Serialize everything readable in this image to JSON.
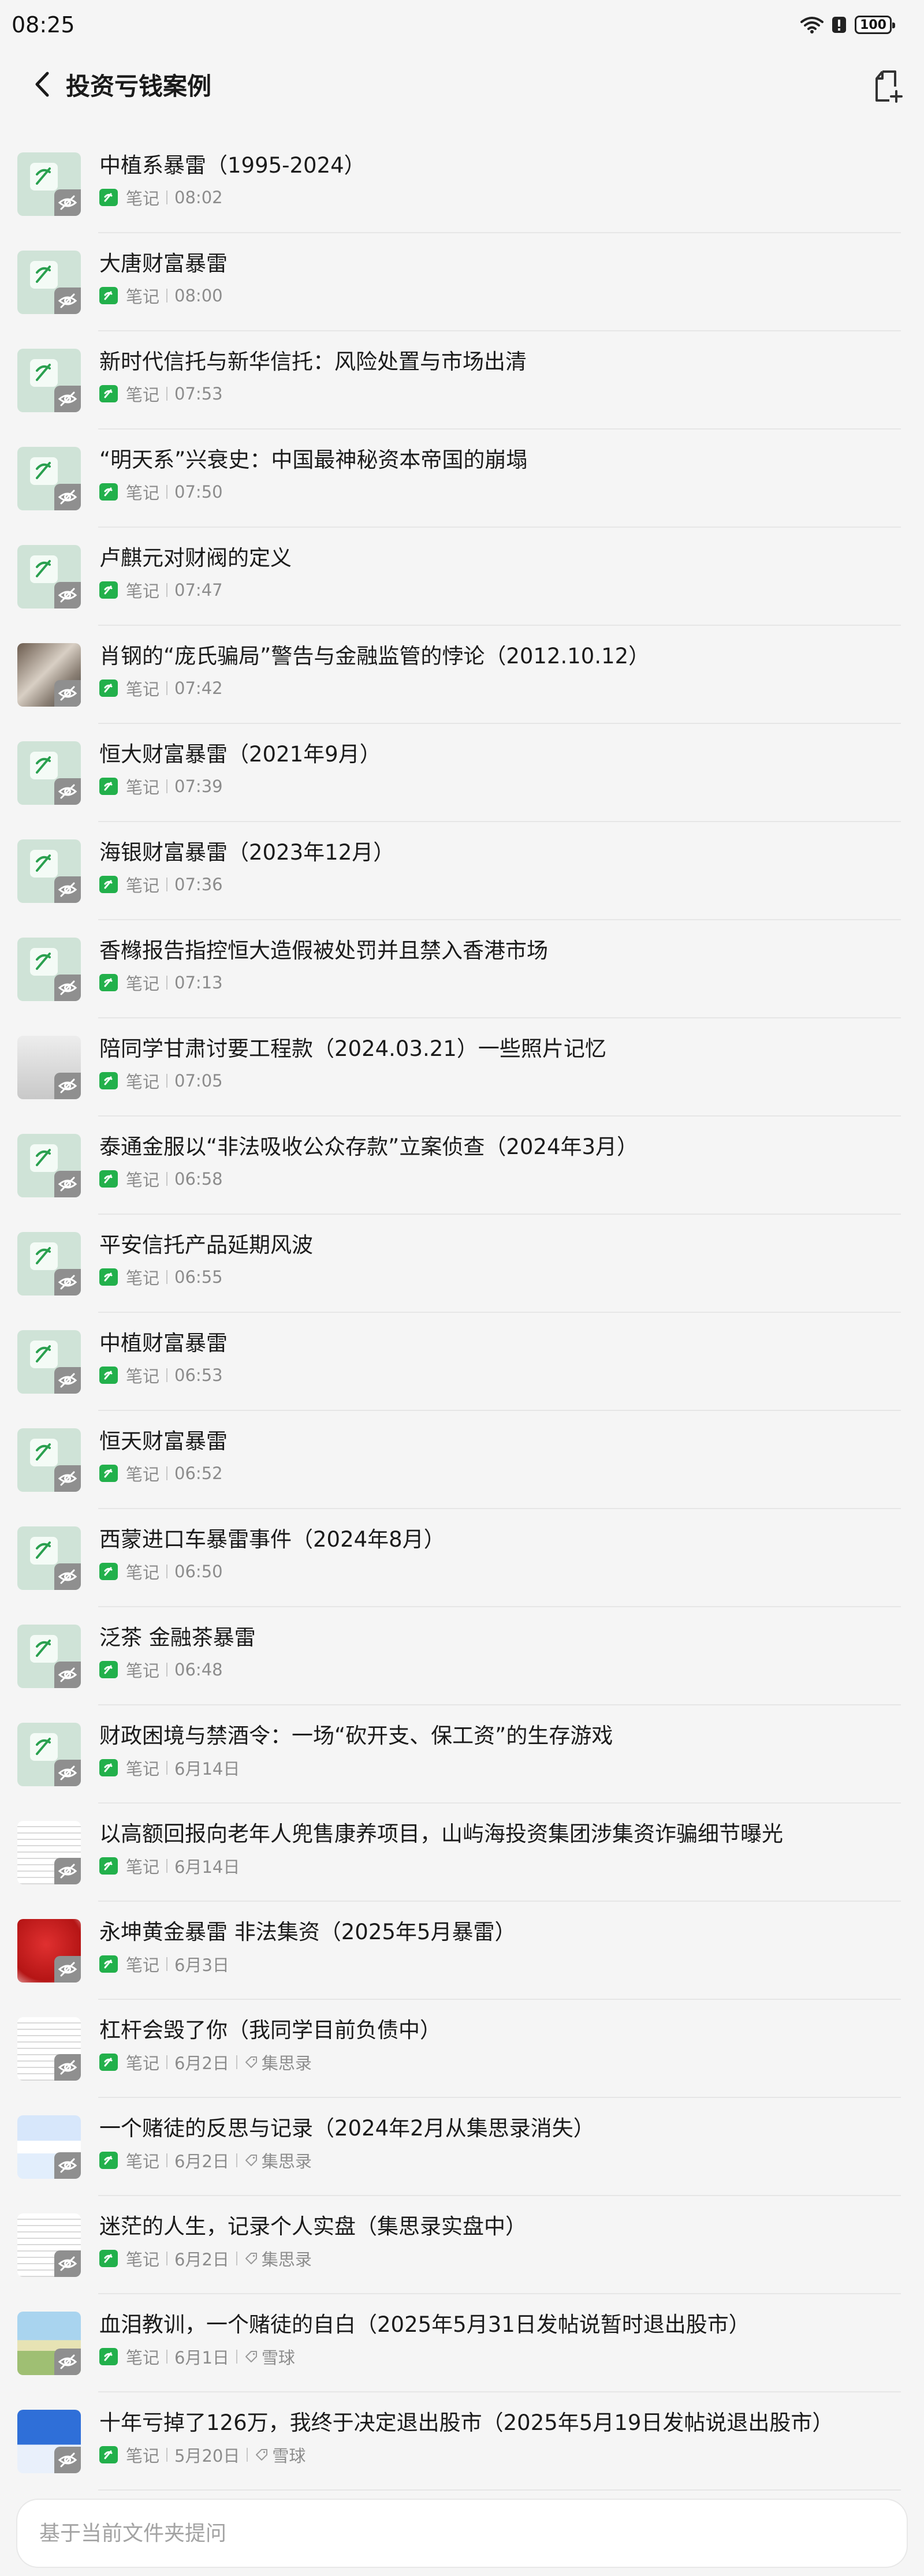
{
  "status": {
    "time": "08:25",
    "battery": "100"
  },
  "header": {
    "title": "投资亏钱案例"
  },
  "notes": [
    {
      "title": "中植系暴雷（1995-2024）",
      "type": "笔记",
      "time": "08:02",
      "tag": "",
      "thumb": "default"
    },
    {
      "title": "大唐财富暴雷",
      "type": "笔记",
      "time": "08:00",
      "tag": "",
      "thumb": "default"
    },
    {
      "title": "新时代信托与新华信托：风险处置与市场出清",
      "type": "笔记",
      "time": "07:53",
      "tag": "",
      "thumb": "default"
    },
    {
      "title": "“明天系”兴衰史：中国最神秘资本帝国的崩塌",
      "type": "笔记",
      "time": "07:50",
      "tag": "",
      "thumb": "default"
    },
    {
      "title": "卢麒元对财阀的定义",
      "type": "笔记",
      "time": "07:47",
      "tag": "",
      "thumb": "default"
    },
    {
      "title": "肖钢的“庞氏骗局”警告与金融监管的悖论（2012.10.12）",
      "type": "笔记",
      "time": "07:42",
      "tag": "",
      "thumb": "photo"
    },
    {
      "title": "恒大财富暴雷（2021年9月）",
      "type": "笔记",
      "time": "07:39",
      "tag": "",
      "thumb": "default"
    },
    {
      "title": "海银财富暴雷（2023年12月）",
      "type": "笔记",
      "time": "07:36",
      "tag": "",
      "thumb": "default"
    },
    {
      "title": "香橼报告指控恒大造假被处罚并且禁入香港市场",
      "type": "笔记",
      "time": "07:13",
      "tag": "",
      "thumb": "default"
    },
    {
      "title": "陪同学甘肃讨要工程款（2024.03.21）一些照片记忆",
      "type": "笔记",
      "time": "07:05",
      "tag": "",
      "thumb": "doc"
    },
    {
      "title": "泰通金服以“非法吸收公众存款”立案侦查（2024年3月）",
      "type": "笔记",
      "time": "06:58",
      "tag": "",
      "thumb": "default"
    },
    {
      "title": "平安信托产品延期风波",
      "type": "笔记",
      "time": "06:55",
      "tag": "",
      "thumb": "default"
    },
    {
      "title": "中植财富暴雷",
      "type": "笔记",
      "time": "06:53",
      "tag": "",
      "thumb": "default"
    },
    {
      "title": "恒天财富暴雷",
      "type": "笔记",
      "time": "06:52",
      "tag": "",
      "thumb": "default"
    },
    {
      "title": "西蒙进口车暴雷事件（2024年8月）",
      "type": "笔记",
      "time": "06:50",
      "tag": "",
      "thumb": "default"
    },
    {
      "title": "泛茶 金融茶暴雷",
      "type": "笔记",
      "time": "06:48",
      "tag": "",
      "thumb": "default"
    },
    {
      "title": "财政困境与禁酒令：一场“砍开支、保工资”的生存游戏",
      "type": "笔记",
      "time": "6月14日",
      "tag": "",
      "thumb": "default"
    },
    {
      "title": "以高额回报向老年人兜售康养项目，山屿海投资集团涉集资诈骗细节曝光",
      "type": "笔记",
      "time": "6月14日",
      "tag": "",
      "thumb": "screen"
    },
    {
      "title": "永坤黄金暴雷 非法集资（2025年5月暴雷）",
      "type": "笔记",
      "time": "6月3日",
      "tag": "",
      "thumb": "red"
    },
    {
      "title": "杠杆会毁了你（我同学目前负债中）",
      "type": "笔记",
      "time": "6月2日",
      "tag": "集思录",
      "thumb": "screen"
    },
    {
      "title": "一个赌徒的反思与记录（2024年2月从集思录消失）",
      "type": "笔记",
      "time": "6月2日",
      "tag": "集思录",
      "thumb": "blue"
    },
    {
      "title": "迷茫的人生，记录个人实盘（集思录实盘中）",
      "type": "笔记",
      "time": "6月2日",
      "tag": "集思录",
      "thumb": "screen"
    },
    {
      "title": "血泪教训，一个赌徒的自白（2025年5月31日发帖说暂时退出股市）",
      "type": "笔记",
      "time": "6月1日",
      "tag": "雪球",
      "thumb": "landscape"
    },
    {
      "title": "十年亏掉了126万，我终于决定退出股市（2025年5月19日发帖说退出股市）",
      "type": "笔记",
      "time": "5月20日",
      "tag": "雪球",
      "thumb": "bluecard"
    }
  ],
  "ask": {
    "placeholder": "基于当前文件夹提问"
  },
  "colors": {
    "note_icon": "#22b04b",
    "thumb_default": "#cfe3d7",
    "background": "#f5f5f5"
  }
}
